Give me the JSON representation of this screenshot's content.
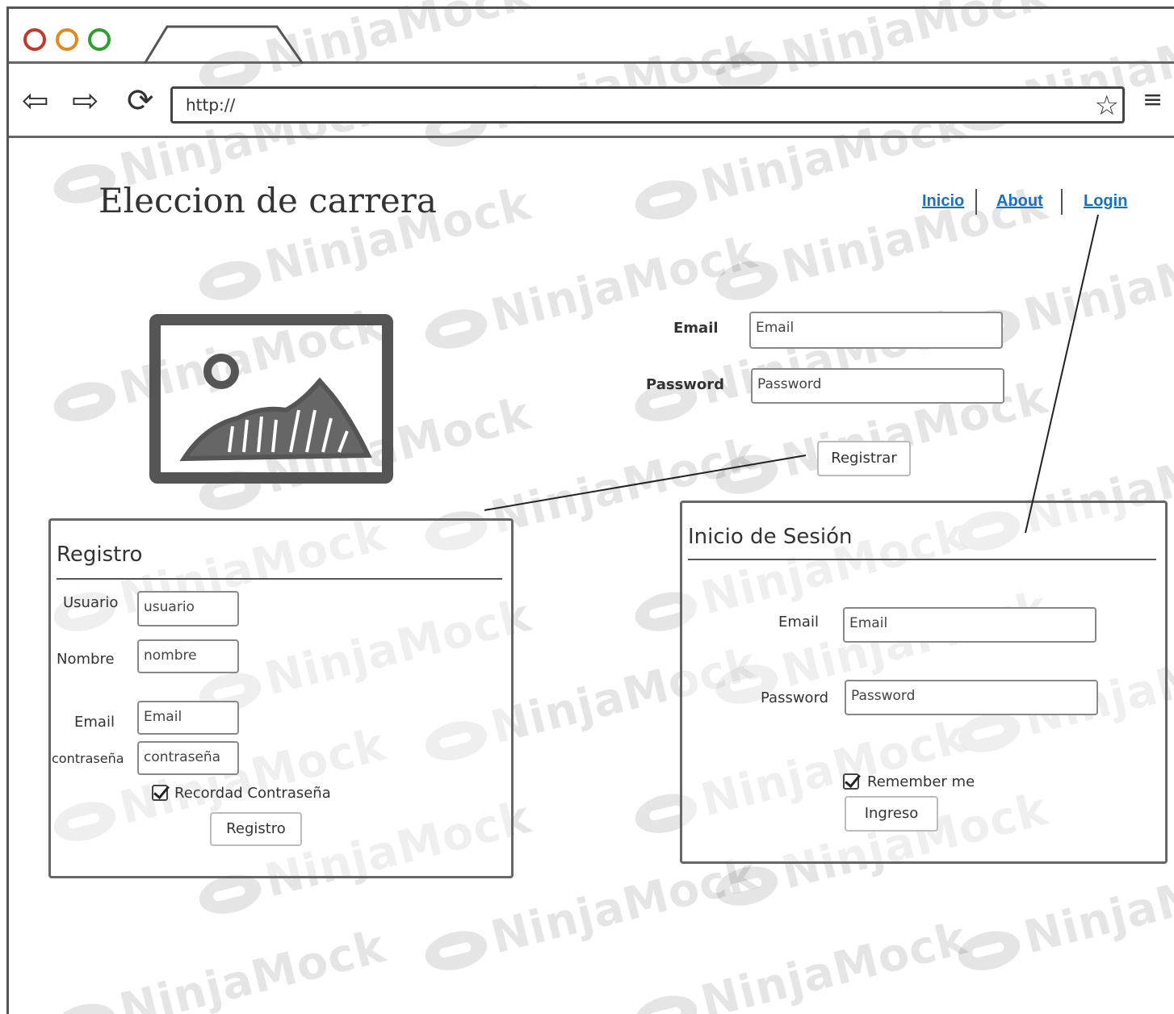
{
  "watermark": "NinjaMock",
  "browser": {
    "url": "http://",
    "window_dots": [
      "#c0392b",
      "#e08a1e",
      "#2e9e2e"
    ]
  },
  "header": {
    "title": "Eleccion de carrera",
    "nav": [
      "Inicio",
      "About",
      "Login"
    ],
    "link_color": "#1a6fc1"
  },
  "top_form": {
    "email_label": "Email",
    "email_placeholder": "Email",
    "password_label": "Password",
    "password_placeholder": "Password",
    "button": "Registrar"
  },
  "registro": {
    "title": "Registro",
    "usuario_label": "Usuario",
    "usuario_placeholder": "usuario",
    "nombre_label": "Nombre",
    "nombre_placeholder": "nombre",
    "email_label": "Email",
    "email_placeholder": "Email",
    "password_label": "contraseña",
    "password_placeholder": "contraseña",
    "remember": "Recordad Contraseña",
    "remember_checked": true,
    "button": "Registro"
  },
  "login": {
    "title": "Inicio de Sesión",
    "email_label": "Email",
    "email_placeholder": "Email",
    "password_label": "Password",
    "password_placeholder": "Password",
    "remember": "Remember me",
    "remember_checked": true,
    "button": "Ingreso"
  }
}
